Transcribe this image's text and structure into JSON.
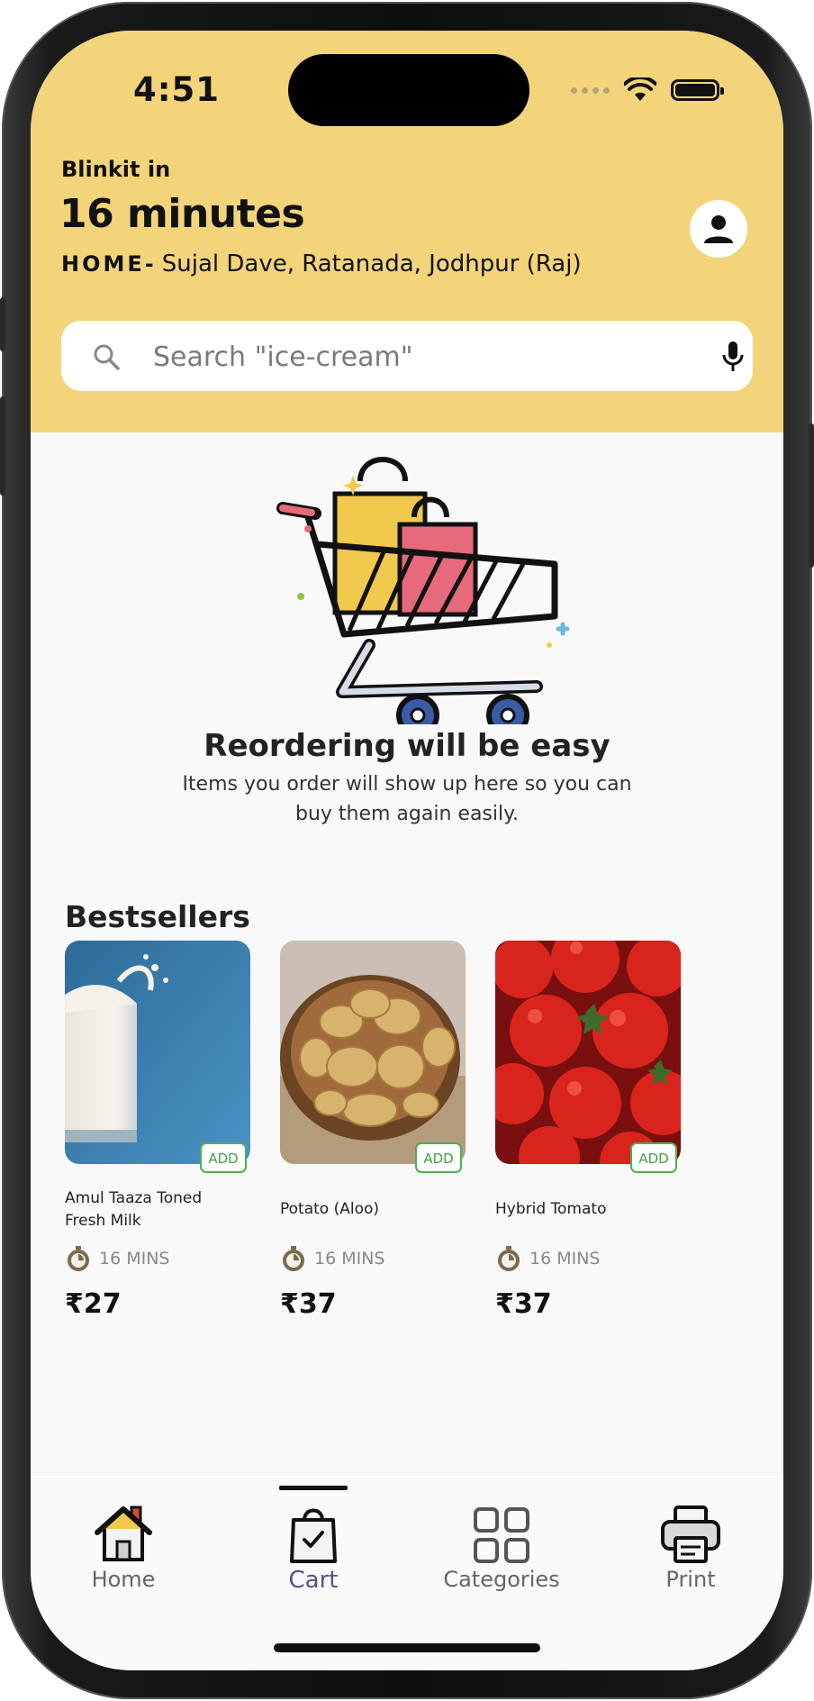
{
  "status_bar": {
    "time": "4:51"
  },
  "header": {
    "brand_line": "Blinkit in",
    "eta": "16 minutes",
    "address_label": "HOME-",
    "address": "Sujal Dave, Ratanada, Jodhpur (Raj)"
  },
  "search": {
    "placeholder": "Search \"ice-cream\""
  },
  "empty_state": {
    "title": "Reordering will be easy",
    "subtitle": "Items you order will show up here so you can buy them again easily."
  },
  "bestsellers": {
    "title": "Bestsellers",
    "add_label": "ADD",
    "items": [
      {
        "name": "Amul Taaza Toned Fresh Milk",
        "time": "16 MINS",
        "price": "27"
      },
      {
        "name": "Potato (Aloo)",
        "time": "16 MINS",
        "price": "37"
      },
      {
        "name": "Hybrid Tomato",
        "time": "16 MINS",
        "price": "37"
      }
    ]
  },
  "currency_symbol": "₹",
  "bottom_nav": {
    "active": "Cart",
    "items": [
      {
        "label": "Home",
        "icon": "home-icon"
      },
      {
        "label": "Cart",
        "icon": "shopping-bag-icon"
      },
      {
        "label": "Categories",
        "icon": "grid-icon"
      },
      {
        "label": "Print",
        "icon": "printer-icon"
      }
    ]
  },
  "colors": {
    "header_bg": "#f3d47b",
    "add_green": "#43a047",
    "nav_active": "#5a4f87"
  }
}
